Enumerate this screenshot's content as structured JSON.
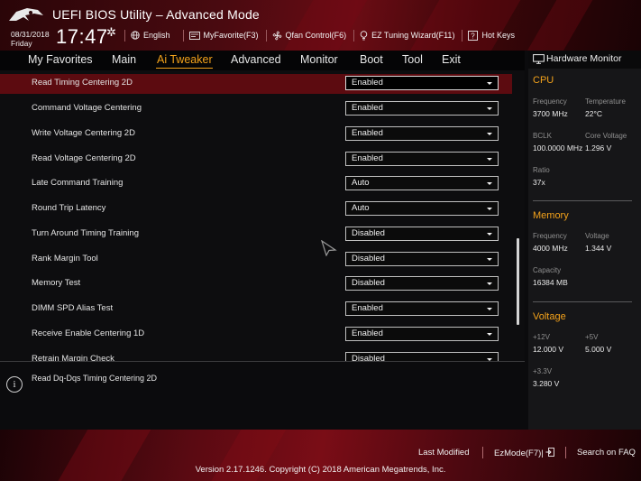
{
  "header": {
    "title": "UEFI BIOS Utility – Advanced Mode",
    "date": "08/31/2018",
    "day": "Friday",
    "time": "17:47",
    "toolbar": [
      {
        "label": "English",
        "icon": "globe-icon"
      },
      {
        "label": "MyFavorite(F3)",
        "icon": "favorite-icon"
      },
      {
        "label": "Qfan Control(F6)",
        "icon": "fan-icon"
      },
      {
        "label": "EZ Tuning Wizard(F11)",
        "icon": "bulb-icon"
      },
      {
        "label": "Hot Keys",
        "icon": "hotkeys-icon"
      }
    ]
  },
  "menu": {
    "items": [
      "My Favorites",
      "Main",
      "Ai Tweaker",
      "Advanced",
      "Monitor",
      "Boot",
      "Tool",
      "Exit"
    ],
    "active": "Ai Tweaker"
  },
  "settings": [
    {
      "label": "Read Timing Centering 2D",
      "value": "Enabled",
      "selected": true
    },
    {
      "label": "Command Voltage Centering",
      "value": "Enabled"
    },
    {
      "label": "Write Voltage Centering 2D",
      "value": "Enabled"
    },
    {
      "label": "Read Voltage Centering 2D",
      "value": "Enabled"
    },
    {
      "label": "Late Command Training",
      "value": "Auto"
    },
    {
      "label": "Round Trip Latency",
      "value": "Auto"
    },
    {
      "label": "Turn Around Timing Training",
      "value": "Disabled"
    },
    {
      "label": "Rank Margin Tool",
      "value": "Disabled"
    },
    {
      "label": "Memory Test",
      "value": "Disabled"
    },
    {
      "label": "DIMM SPD Alias Test",
      "value": "Enabled"
    },
    {
      "label": "Receive Enable Centering 1D",
      "value": "Enabled"
    },
    {
      "label": "Retrain Margin Check",
      "value": "Disabled"
    }
  ],
  "help": {
    "text": "Read Dq-Dqs Timing Centering 2D"
  },
  "hardware_monitor": {
    "title": "Hardware Monitor",
    "cpu": {
      "title": "CPU",
      "frequency_label": "Frequency",
      "frequency": "3700 MHz",
      "temperature_label": "Temperature",
      "temperature": "22°C",
      "bclk_label": "BCLK",
      "bclk": "100.0000 MHz",
      "core_voltage_label": "Core Voltage",
      "core_voltage": "1.296 V",
      "ratio_label": "Ratio",
      "ratio": "37x"
    },
    "memory": {
      "title": "Memory",
      "frequency_label": "Frequency",
      "frequency": "4000 MHz",
      "voltage_label": "Voltage",
      "voltage": "1.344 V",
      "capacity_label": "Capacity",
      "capacity": "16384 MB"
    },
    "voltage": {
      "title": "Voltage",
      "v12_label": "+12V",
      "v12": "12.000 V",
      "v5_label": "+5V",
      "v5": "5.000 V",
      "v33_label": "+3.3V",
      "v33": "3.280 V"
    }
  },
  "footer": {
    "last_modified": "Last Modified",
    "ezmode": "EzMode(F7)|",
    "search_faq": "Search on FAQ",
    "copyright": "Version 2.17.1246. Copyright (C) 2018 American Megatrends, Inc."
  },
  "colors": {
    "accent": "#f3a21b",
    "selected_row": "#5c0b10",
    "header_red": "#6a0c14"
  }
}
